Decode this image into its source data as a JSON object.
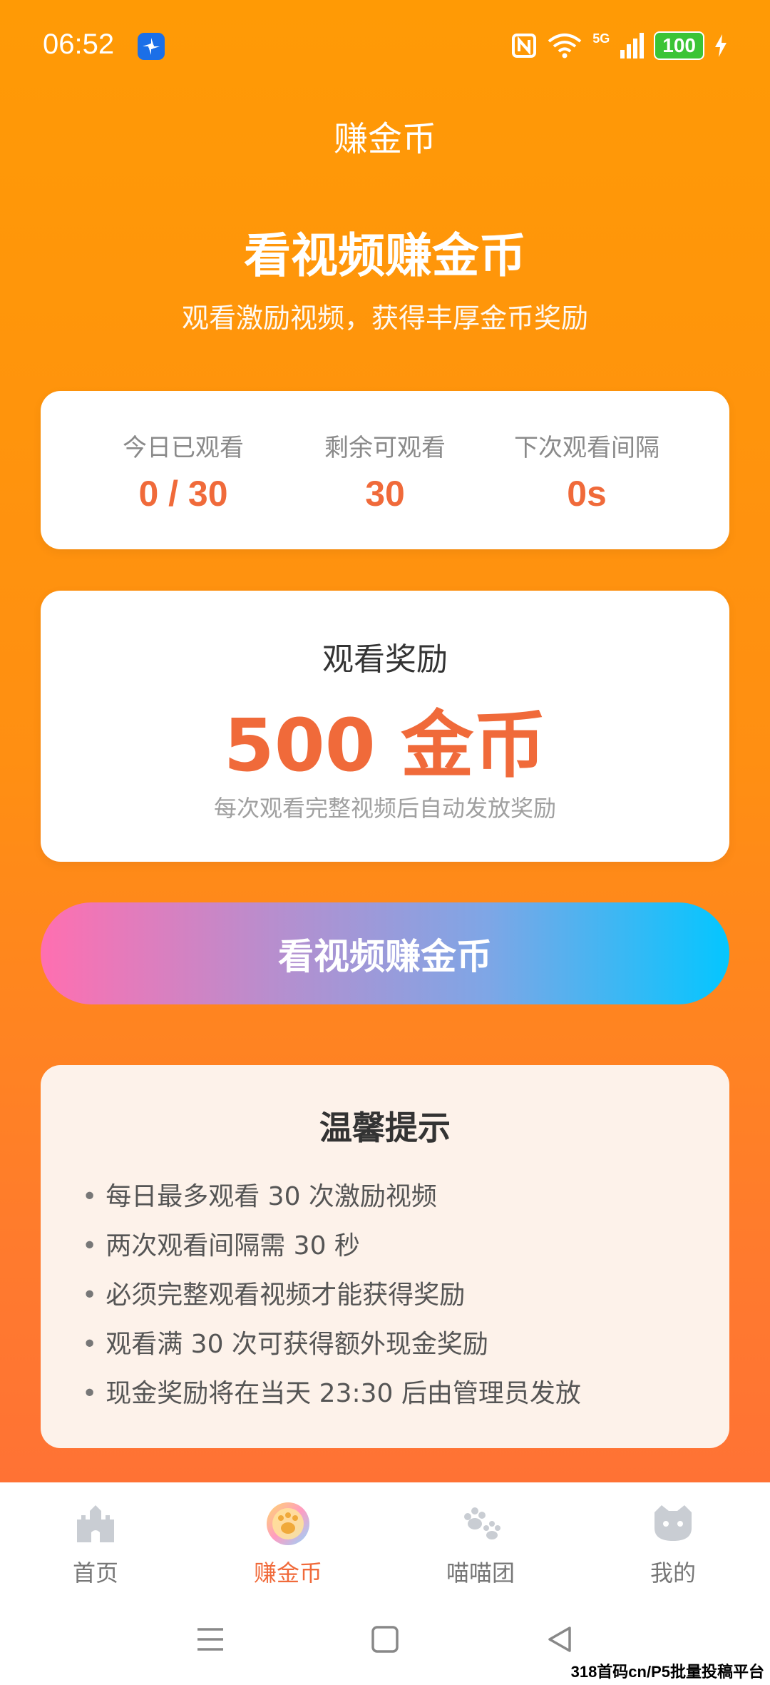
{
  "status": {
    "time": "06:52",
    "battery": "100",
    "network": "5G"
  },
  "header": {
    "title": "赚金币"
  },
  "hero": {
    "title": "看视频赚金币",
    "subtitle": "观看激励视频，获得丰厚金币奖励"
  },
  "stats": [
    {
      "label": "今日已观看",
      "value": "0 / 30"
    },
    {
      "label": "剩余可观看",
      "value": "30"
    },
    {
      "label": "下次观看间隔",
      "value": "0s"
    }
  ],
  "reward": {
    "label": "观看奖励",
    "value": "500 金币",
    "desc": "每次观看完整视频后自动发放奖励"
  },
  "cta": {
    "label": "看视频赚金币"
  },
  "tips": {
    "title": "温馨提示",
    "items": [
      "每日最多观看 30 次激励视频",
      "两次观看间隔需 30 秒",
      "必须完整观看视频才能获得奖励",
      "观看满 30 次可获得额外现金奖励",
      "现金奖励将在当天 23:30 后由管理员发放"
    ]
  },
  "tabs": [
    {
      "label": "首页",
      "icon": "castle-icon"
    },
    {
      "label": "赚金币",
      "icon": "coin-icon",
      "active": true
    },
    {
      "label": "喵喵团",
      "icon": "paw-icon"
    },
    {
      "label": "我的",
      "icon": "cat-face-icon"
    }
  ],
  "watermark": "318首码cn/P5批量投稿平台",
  "colors": {
    "accent": "#F06A3A",
    "background": "#FF9A05",
    "tips_bg": "#FDF2EA"
  }
}
